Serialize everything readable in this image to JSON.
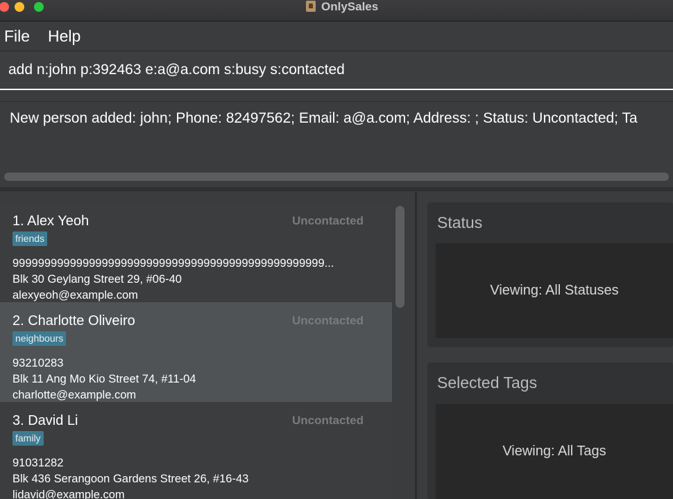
{
  "window": {
    "title": "OnlySales"
  },
  "menu": {
    "items": [
      "File",
      "Help"
    ]
  },
  "command": {
    "value": "add n:john p:392463 e:a@a.com s:busy s:contacted"
  },
  "result": {
    "text": "New person added: john; Phone: 82497562; Email: a@a.com; Address: ; Status: Uncontacted; Ta"
  },
  "persons": [
    {
      "name": "1. Alex Yeoh",
      "status": "Uncontacted",
      "tag": "friends",
      "phone": "9999999999999999999999999999999999999999999999999...",
      "address": "Blk 30 Geylang Street 29, #06-40",
      "email": "alexyeoh@example.com"
    },
    {
      "name": "2. Charlotte Oliveiro",
      "status": "Uncontacted",
      "tag": "neighbours",
      "phone": "93210283",
      "address": "Blk 11 Ang Mo Kio Street 74, #11-04",
      "email": "charlotte@example.com"
    },
    {
      "name": "3. David Li",
      "status": "Uncontacted",
      "tag": "family",
      "phone": "91031282",
      "address": "Blk 436 Serangoon Gardens Street 26, #16-43",
      "email": "lidavid@example.com"
    }
  ],
  "status_panel": {
    "title": "Status",
    "content": "Viewing: All Statuses"
  },
  "tags_panel": {
    "title": "Selected Tags",
    "content": "Viewing: All Tags"
  }
}
